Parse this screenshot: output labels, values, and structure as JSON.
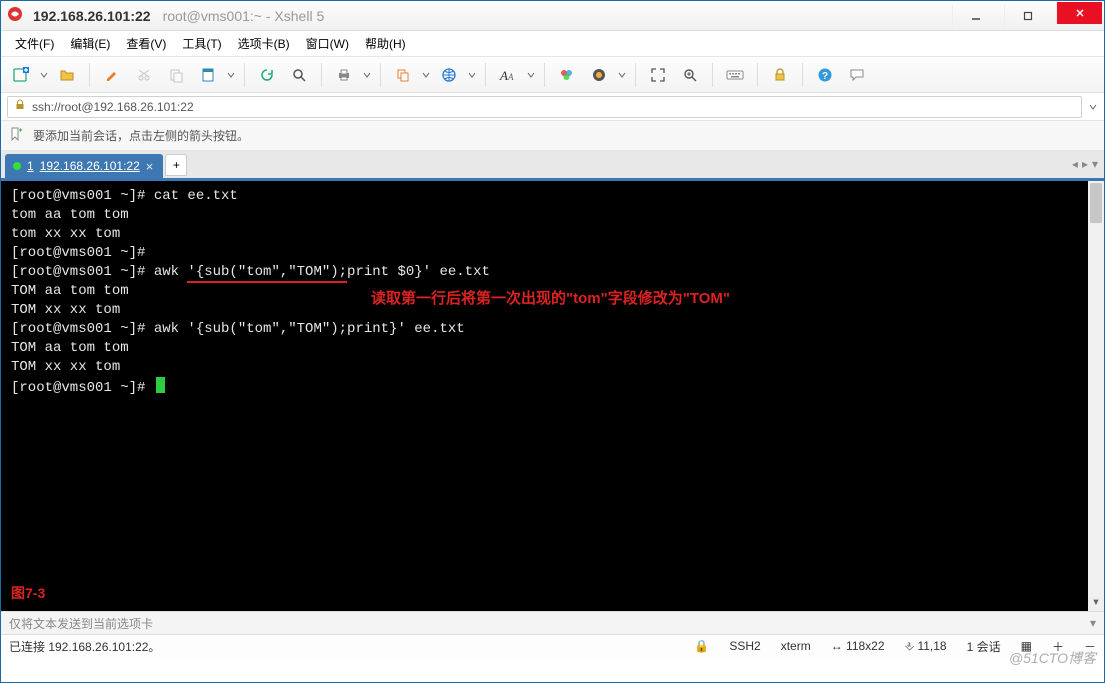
{
  "window": {
    "title_main": "192.168.26.101:22",
    "title_sub": "root@vms001:~ - Xshell 5"
  },
  "menu": {
    "items": [
      "文件(F)",
      "编辑(E)",
      "查看(V)",
      "工具(T)",
      "选项卡(B)",
      "窗口(W)",
      "帮助(H)"
    ]
  },
  "toolbar": {
    "icons": [
      "new-session-icon",
      "open-icon",
      "edit-icon",
      "scissors-icon",
      "paste-icon",
      "properties-icon",
      "reconnect-icon",
      "find-icon",
      "print-icon",
      "copy-icon",
      "globe-icon",
      "font-icon",
      "color-icon",
      "theme-icon",
      "fullscreen-icon",
      "zoom-icon",
      "keyboard-icon",
      "lock-icon",
      "help-icon",
      "chat-icon"
    ]
  },
  "address": {
    "scheme_icon": "lock-icon",
    "url": "ssh://root@192.168.26.101:22"
  },
  "hint": {
    "text": "要添加当前会话，点击左侧的箭头按钮。"
  },
  "tabs": {
    "active": {
      "index_label": "1",
      "label": "192.168.26.101:22"
    }
  },
  "terminal": {
    "lines": [
      "[root@vms001 ~]# cat ee.txt",
      "tom aa tom tom",
      "tom xx xx tom",
      "[root@vms001 ~]#",
      "[root@vms001 ~]# awk '{sub(\"tom\",\"TOM\");print $0}' ee.txt",
      "TOM aa tom tom",
      "TOM xx xx tom",
      "[root@vms001 ~]# awk '{sub(\"tom\",\"TOM\");print}' ee.txt",
      "TOM aa tom tom",
      "TOM xx xx tom",
      "[root@vms001 ~]# "
    ],
    "annotation": "读取第一行后将第一次出现的\"tom\"字段修改为\"TOM\"",
    "figure_label": "图7-3",
    "underline": {
      "line_index": 4,
      "char_start": 22,
      "char_end": 39
    }
  },
  "sendbar": {
    "text": "仅将文本发送到当前选项卡"
  },
  "status": {
    "left": "已连接 192.168.26.101:22。",
    "protocol_icon": "ssh-icon",
    "protocol": "SSH2",
    "term": "xterm",
    "size": "118x22",
    "pos_icon": "caret-icon",
    "pos": "11,18",
    "sessions": "1 会话",
    "extra_icons": [
      "grid-icon",
      "plus-icon",
      "minus-icon"
    ]
  },
  "watermark": "@51CTO博客"
}
